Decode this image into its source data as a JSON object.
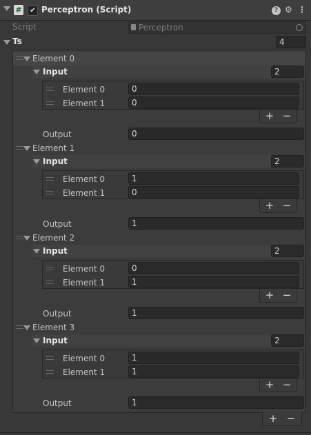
{
  "component": {
    "title": "Perceptron (Script)",
    "enabled": "✔",
    "script_label": "Script",
    "script_value": "Perceptron",
    "help_icon": "question-icon",
    "settings_icon": "sliders-icon",
    "menu_icon": "kebab-menu-icon"
  },
  "ts": {
    "label": "Ts",
    "size": "4",
    "elements": [
      {
        "label": "Element 0",
        "input_label": "Input",
        "input_size": "2",
        "inputs": [
          {
            "label": "Element 0",
            "value": "0"
          },
          {
            "label": "Element 1",
            "value": "0"
          }
        ],
        "output_label": "Output",
        "output_value": "0"
      },
      {
        "label": "Element 1",
        "input_label": "Input",
        "input_size": "2",
        "inputs": [
          {
            "label": "Element 0",
            "value": "1"
          },
          {
            "label": "Element 1",
            "value": "0"
          }
        ],
        "output_label": "Output",
        "output_value": "1"
      },
      {
        "label": "Element 2",
        "input_label": "Input",
        "input_size": "2",
        "inputs": [
          {
            "label": "Element 0",
            "value": "0"
          },
          {
            "label": "Element 1",
            "value": "1"
          }
        ],
        "output_label": "Output",
        "output_value": "1"
      },
      {
        "label": "Element 3",
        "input_label": "Input",
        "input_size": "2",
        "inputs": [
          {
            "label": "Element 0",
            "value": "1"
          },
          {
            "label": "Element 1",
            "value": "1"
          }
        ],
        "output_label": "Output",
        "output_value": "1"
      }
    ]
  },
  "buttons": {
    "plus": "+",
    "minus": "−"
  }
}
